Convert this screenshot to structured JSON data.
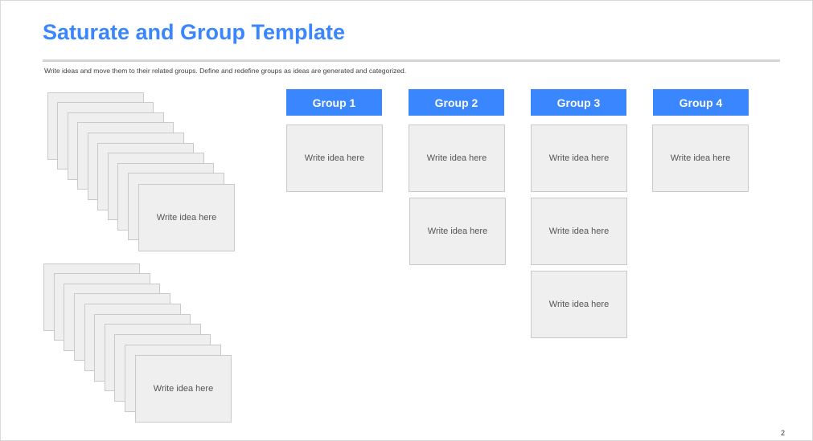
{
  "slide": {
    "title": "Saturate and Group Template",
    "subtitle": "Write ideas and move them to their related groups. Define and redefine groups as ideas are generated and categorized.",
    "page_number": "2"
  },
  "placeholder_text": "Write idea here",
  "stack_1": {
    "cards": [
      "",
      "",
      "",
      "",
      "",
      "",
      "",
      "",
      "",
      "Write idea here"
    ]
  },
  "stack_2": {
    "cards": [
      "",
      "",
      "",
      "",
      "",
      "",
      "",
      "",
      "",
      "Write idea here"
    ]
  },
  "groups": [
    {
      "label": "Group 1",
      "ideas": [
        "Write idea here"
      ]
    },
    {
      "label": "Group 2",
      "ideas": [
        "Write idea here",
        "Write idea here"
      ]
    },
    {
      "label": "Group 3",
      "ideas": [
        "Write idea here",
        "Write idea here",
        "Write idea here"
      ]
    },
    {
      "label": "Group 4",
      "ideas": [
        "Write idea here"
      ]
    }
  ],
  "colors": {
    "accent": "#3a86ff",
    "card_fill": "#efefef",
    "card_border": "#c9c9c9",
    "rule": "#d4d4d4"
  }
}
